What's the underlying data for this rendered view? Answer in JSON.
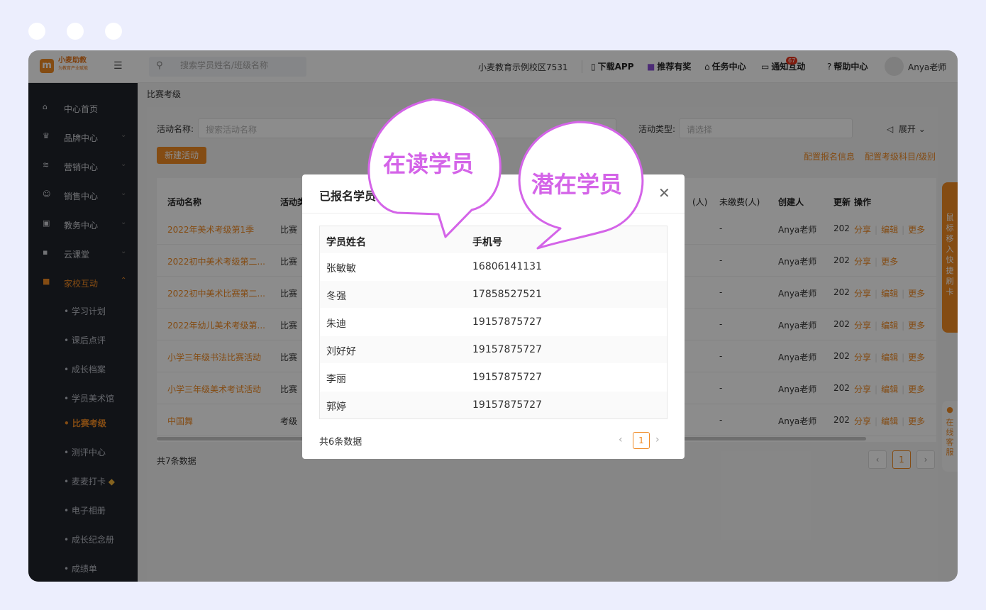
{
  "topbar": {
    "logo_title": "小麦助教",
    "logo_sub": "为教育产业赋能",
    "search_placeholder": "搜索学员姓名/班级名称",
    "school": "小麦教育示例校区7531",
    "items": [
      "下载APP",
      "推荐有奖",
      "任务中心",
      "通知互动",
      "帮助中心"
    ],
    "notify_count": "67",
    "user": "Anya老师"
  },
  "sidebar": {
    "items": [
      {
        "label": "中心首页",
        "icon": "home-icon"
      },
      {
        "label": "品牌中心",
        "icon": "crown-icon"
      },
      {
        "label": "营销中心",
        "icon": "layers-icon"
      },
      {
        "label": "销售中心",
        "icon": "users-icon"
      },
      {
        "label": "教务中心",
        "icon": "bag-icon"
      },
      {
        "label": "云课堂",
        "icon": "screen-icon"
      },
      {
        "label": "家校互动",
        "icon": "chat-icon"
      }
    ],
    "subitems": [
      "学习计划",
      "课后点评",
      "成长档案",
      "学员美术馆",
      "比赛考级",
      "测评中心",
      "麦麦打卡",
      "电子相册",
      "成长纪念册",
      "成绩单"
    ]
  },
  "breadcrumb": "比赛考级",
  "filters": {
    "name_label": "活动名称:",
    "name_placeholder": "搜索活动名称",
    "type_label": "活动类型:",
    "type_placeholder": "请选择",
    "expand": "展开"
  },
  "buttons": {
    "new_activity": "新建活动",
    "config_signup": "配置报名信息",
    "config_exam": "配置考级科目/级别"
  },
  "table": {
    "headers": [
      "活动名称",
      "活动类",
      "(人)",
      "未缴费(人)",
      "创建人",
      "更新",
      "操作"
    ],
    "rows": [
      {
        "name": "2022年美术考级第1季",
        "type": "比赛",
        "unpaid": "-",
        "creator": "Anya老师",
        "date": "202",
        "ops": [
          "分享",
          "编辑",
          "更多"
        ]
      },
      {
        "name": "2022初中美术考级第二...",
        "type": "比赛",
        "unpaid": "-",
        "creator": "Anya老师",
        "date": "202",
        "ops": [
          "分享",
          "更多"
        ]
      },
      {
        "name": "2022初中美术比赛第二...",
        "type": "比赛",
        "unpaid": "-",
        "creator": "Anya老师",
        "date": "202",
        "ops": [
          "分享",
          "编辑",
          "更多"
        ]
      },
      {
        "name": "2022年幼儿美术考级第...",
        "type": "比赛",
        "unpaid": "-",
        "creator": "Anya老师",
        "date": "202",
        "ops": [
          "分享",
          "编辑",
          "更多"
        ]
      },
      {
        "name": "小学三年级书法比赛活动",
        "type": "比赛",
        "unpaid": "-",
        "creator": "Anya老师",
        "date": "202",
        "ops": [
          "分享",
          "编辑",
          "更多"
        ]
      },
      {
        "name": "小学三年级美术考试活动",
        "type": "比赛",
        "unpaid": "-",
        "creator": "Anya老师",
        "date": "202",
        "ops": [
          "分享",
          "编辑",
          "更多"
        ]
      },
      {
        "name": "中国舞",
        "type": "考级",
        "unpaid": "-",
        "creator": "Anya老师",
        "date": "202",
        "ops": [
          "分享",
          "编辑",
          "更多"
        ]
      }
    ],
    "total": "共7条数据",
    "page": "1"
  },
  "side_tabs": {
    "quick_card": "鼠标移入快捷刷卡",
    "service": "在线客服"
  },
  "modal": {
    "title": "已报名学员",
    "headers": [
      "学员姓名",
      "手机号"
    ],
    "rows": [
      {
        "name": "张敏敏",
        "phone": "16806141131"
      },
      {
        "name": "冬强",
        "phone": "17858527521"
      },
      {
        "name": "朱迪",
        "phone": "19157875727"
      },
      {
        "name": "刘好好",
        "phone": "19157875727"
      },
      {
        "name": "李丽",
        "phone": "19157875727"
      },
      {
        "name": "郭婷",
        "phone": "19157875727"
      }
    ],
    "total": "共6条数据",
    "page": "1"
  },
  "bubbles": [
    "在读学员",
    "潜在学员"
  ],
  "colors": {
    "accent": "#f08a24",
    "sidebar": "#20232b",
    "bubble": "#d464e8",
    "frame": "#eceefd"
  }
}
